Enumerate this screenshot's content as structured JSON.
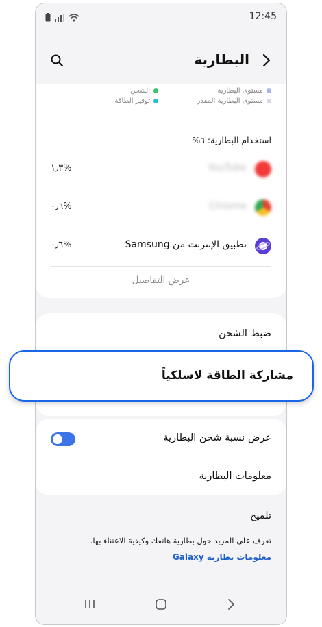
{
  "statusbar": {
    "time": "12:45"
  },
  "header": {
    "title": "البطارية"
  },
  "legend": {
    "battery_level": "مستوى البطارية",
    "estimated_level": "مستوى البطارية المقدر",
    "charging": "الشحن",
    "power_saving": "توفير الطاقة"
  },
  "usage": {
    "title": "استخدام البطارية: ٦%",
    "apps": [
      {
        "name": "YouTube",
        "percent": "%١٫٣"
      },
      {
        "name": "Chrome",
        "percent": "%٠٫٦"
      },
      {
        "name": "تطبيق الإنترنت من Samsung",
        "percent": "%٠٫٦"
      }
    ],
    "details_link": "عرض التفاصيل"
  },
  "settings": {
    "charging_settings": "ضبط الشحن",
    "wireless_powershare": "مشاركة الطاقة لاسلكياً",
    "show_percentage": "عرض نسبة شحن البطارية",
    "show_percentage_on": true,
    "battery_info": "معلومات البطارية"
  },
  "tip": {
    "title": "تلميح",
    "body": "تعرف على المزيد حول بطارية هاتفك وكيفية الاعتناء بها.",
    "link": "معلومات بطارية Galaxy"
  },
  "colors": {
    "accent": "#1a66e6",
    "battery_level_dot": "#a9b7e8",
    "estimated_dot": "#d6d9e6",
    "charging_dot": "#3cc36a",
    "power_saving_dot": "#22c1d6",
    "toggle_on": "#3e73e8",
    "link": "#1f5fc9"
  }
}
